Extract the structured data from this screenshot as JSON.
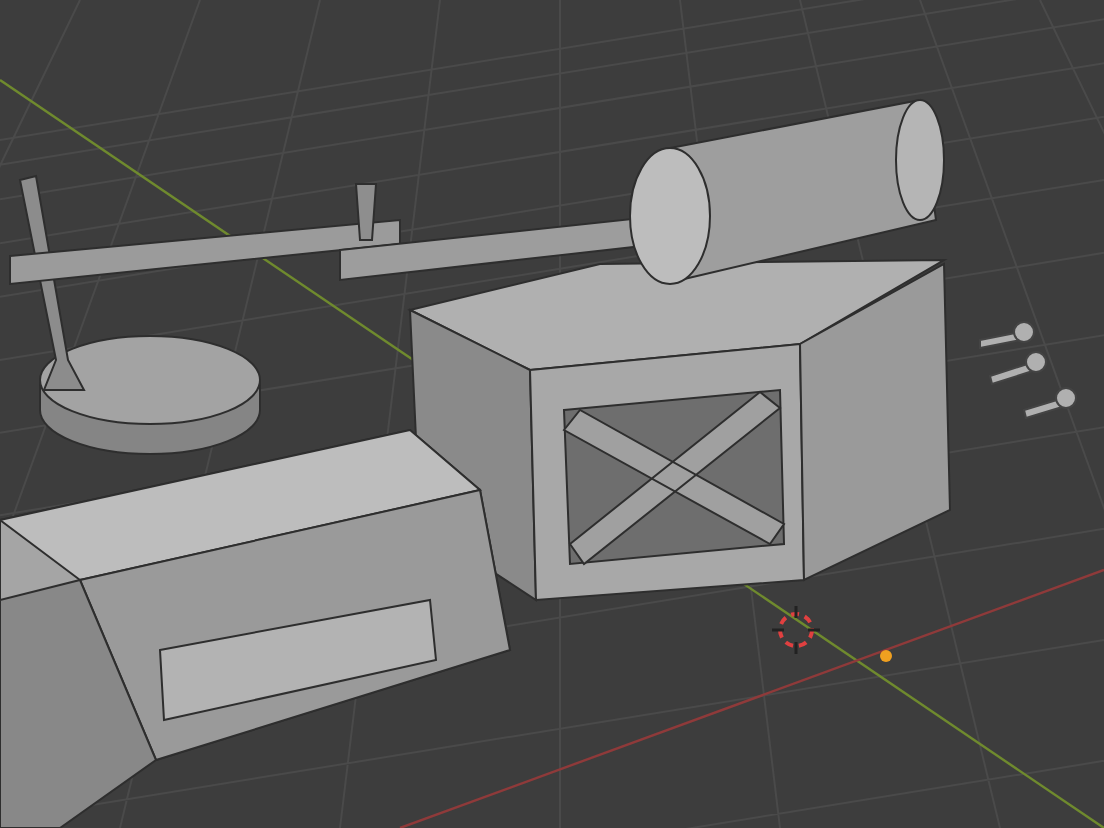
{
  "viewport": {
    "grid_visible": true,
    "cursor_visible": true
  }
}
